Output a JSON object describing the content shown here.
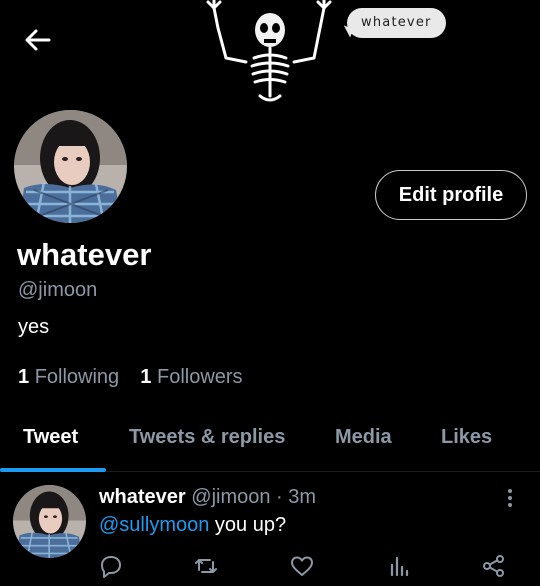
{
  "header": {
    "back_icon": "arrow-left-icon",
    "decoration": "skeleton-icon",
    "bubble_text": "whatever"
  },
  "profile": {
    "display_name": "whatever",
    "handle": "@jimoon",
    "bio": "yes",
    "edit_button_label": "Edit profile",
    "following_count": "1",
    "following_label": "Following",
    "followers_count": "1",
    "followers_label": "Followers"
  },
  "tabs": [
    {
      "label": "Tweet",
      "active": true
    },
    {
      "label": "Tweets & replies",
      "active": false
    },
    {
      "label": "Media",
      "active": false
    },
    {
      "label": "Likes",
      "active": false
    }
  ],
  "tweet": {
    "name": "whatever",
    "meta": "@jimoon · 3m",
    "mention": "@sullymoon",
    "text": " you up?",
    "actions": [
      "reply-icon",
      "retweet-icon",
      "heart-icon",
      "stats-icon",
      "share-icon"
    ]
  },
  "colors": {
    "background": "#000000",
    "accent": "#1d9bf0",
    "secondary_text": "#8b98a5",
    "bubble": "#e9e9e9"
  }
}
